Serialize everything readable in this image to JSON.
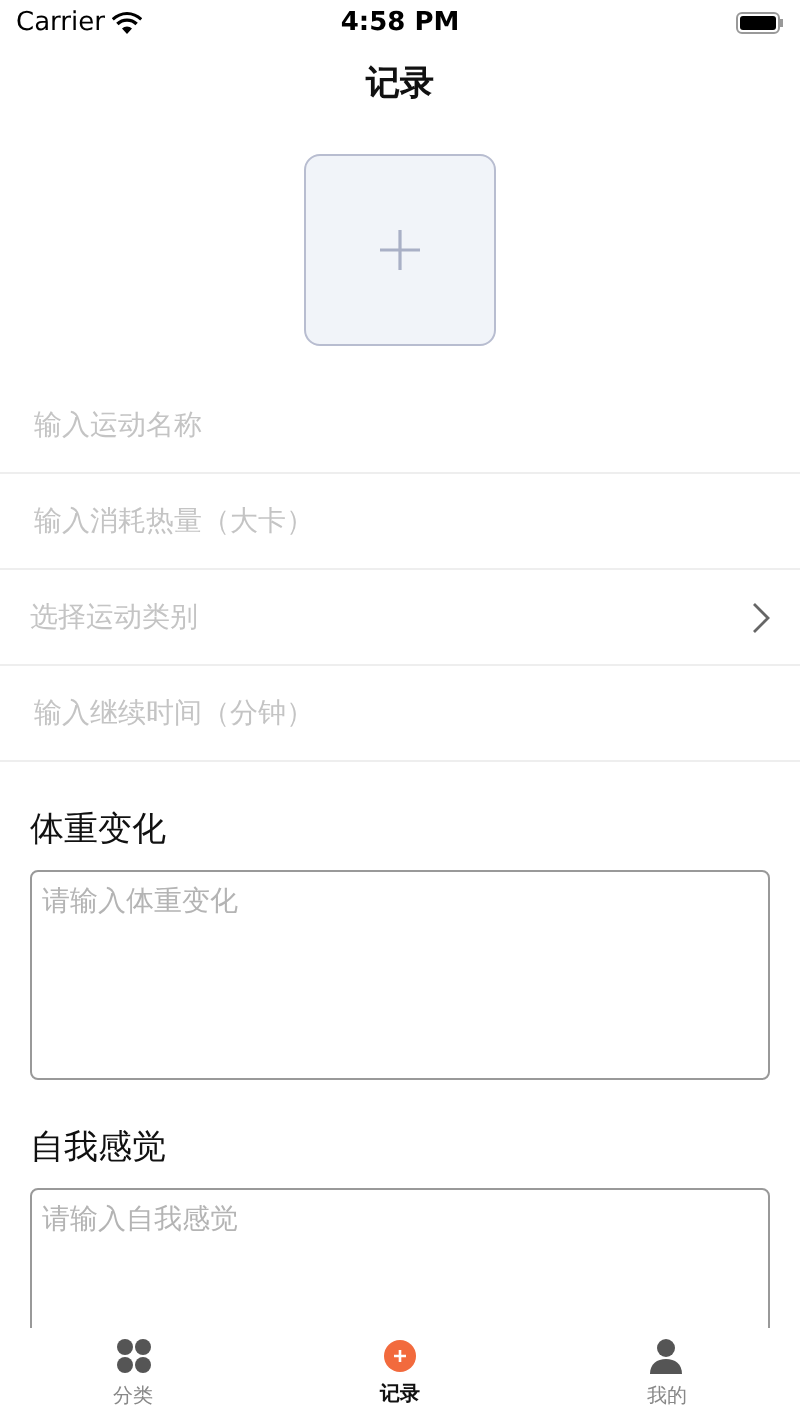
{
  "status_bar": {
    "carrier": "Carrier",
    "time": "4:58 PM"
  },
  "nav": {
    "title": "记录"
  },
  "form_rows": [
    {
      "kind": "input",
      "placeholder": "输入运动名称"
    },
    {
      "kind": "input",
      "placeholder": "输入消耗热量（大卡）"
    },
    {
      "kind": "select",
      "placeholder": "选择运动类别"
    },
    {
      "kind": "input",
      "placeholder": "输入继续时间（分钟）"
    }
  ],
  "sections": [
    {
      "title": "体重变化",
      "placeholder": "请输入体重变化"
    },
    {
      "title": "自我感觉",
      "placeholder": "请输入自我感觉"
    }
  ],
  "tab_bar": [
    {
      "label": "分类",
      "kind": "grid",
      "selected": false
    },
    {
      "label": "记录",
      "kind": "plus",
      "selected": true
    },
    {
      "label": "我的",
      "kind": "user",
      "selected": false
    }
  ]
}
